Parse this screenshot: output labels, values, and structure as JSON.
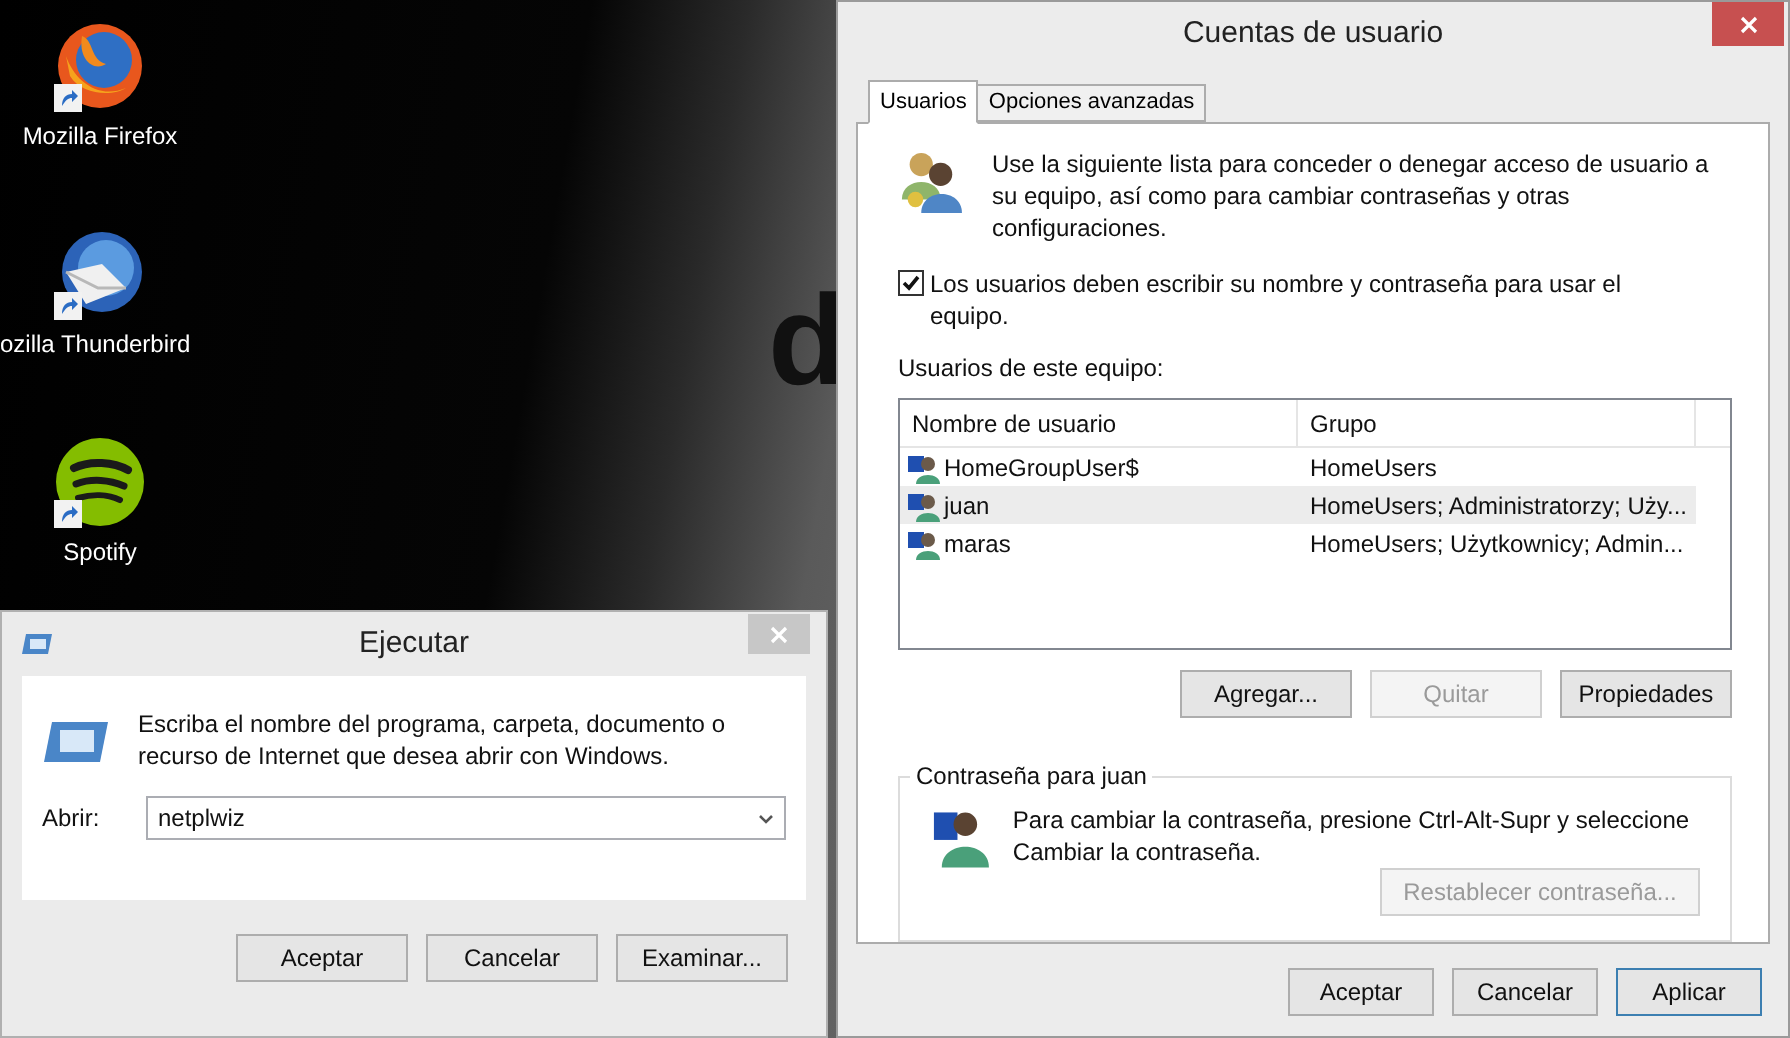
{
  "desktop": {
    "wallpaper_text": "d",
    "icons": [
      {
        "label": "Mozilla Firefox",
        "kind": "firefox"
      },
      {
        "label": "ozilla Thunderbird",
        "kind": "thunderbird"
      },
      {
        "label": "Spotify",
        "kind": "spotify"
      }
    ]
  },
  "accounts_window": {
    "title": "Cuentas de usuario",
    "tabs": [
      {
        "label": "Usuarios",
        "selected": true
      },
      {
        "label": "Opciones avanzadas",
        "selected": false
      }
    ],
    "intro": "Use la siguiente lista para conceder o denegar acceso de usuario a su equipo, así como para cambiar contraseñas y otras configuraciones.",
    "require_password": {
      "label": "Los usuarios deben escribir su nombre y contraseña para usar el equipo.",
      "checked": true
    },
    "users_label": "Usuarios de este equipo:",
    "table": {
      "columns": [
        "Nombre de usuario",
        "Grupo"
      ],
      "rows": [
        {
          "name": "HomeGroupUser$",
          "group": "HomeUsers",
          "selected": false
        },
        {
          "name": "juan",
          "group": "HomeUsers; Administratorzy; Uży...",
          "selected": true
        },
        {
          "name": "maras",
          "group": "HomeUsers; Użytkownicy; Admin...",
          "selected": false
        }
      ]
    },
    "buttons": [
      {
        "label": "Agregar...",
        "disabled": false
      },
      {
        "label": "Quitar",
        "disabled": true
      },
      {
        "label": "Propiedades",
        "disabled": false
      }
    ],
    "password_group": {
      "title": "Contraseña para juan",
      "text": "Para cambiar la contraseña, presione Ctrl-Alt-Supr y seleccione Cambiar la contraseña.",
      "button": {
        "label": "Restablecer contraseña...",
        "disabled": true
      }
    },
    "footer_buttons": [
      {
        "label": "Aceptar",
        "disabled": false,
        "focused": false
      },
      {
        "label": "Cancelar",
        "disabled": false,
        "focused": false
      },
      {
        "label": "Aplicar",
        "disabled": false,
        "focused": true
      }
    ]
  },
  "run_dialog": {
    "title": "Ejecutar",
    "message": "Escriba el nombre del programa, carpeta, documento o recurso de Internet que desea abrir con Windows.",
    "open_label": "Abrir:",
    "open_value": "netplwiz",
    "buttons": [
      "Aceptar",
      "Cancelar",
      "Examinar..."
    ]
  }
}
